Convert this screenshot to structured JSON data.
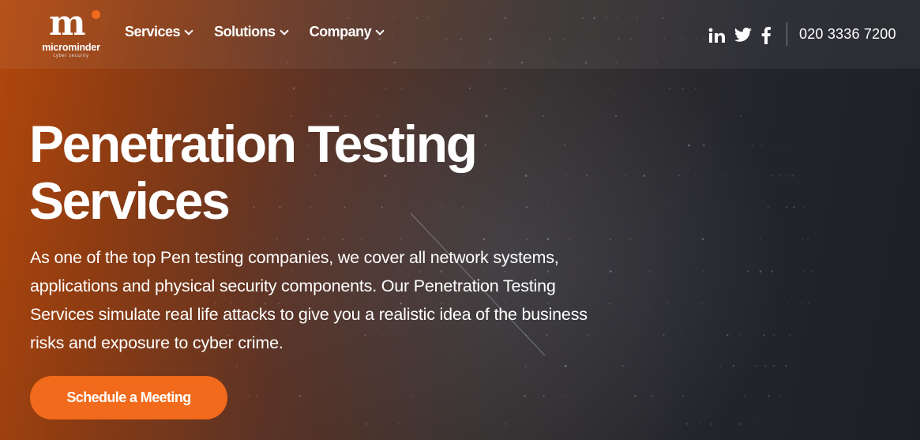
{
  "brand": {
    "mark": "m",
    "name": "microminder",
    "tagline": "cyber security",
    "accent_color": "#f26a1b"
  },
  "nav": {
    "items": [
      {
        "label": "Services",
        "icon": "chevron-down-icon"
      },
      {
        "label": "Solutions",
        "icon": "chevron-down-icon"
      },
      {
        "label": "Company",
        "icon": "chevron-down-icon"
      }
    ]
  },
  "social": {
    "icons": [
      "linkedin-icon",
      "twitter-icon",
      "facebook-icon"
    ]
  },
  "contact": {
    "phone": "020 3336 7200"
  },
  "hero": {
    "title_line1": "Penetration Testing",
    "title_line2": "Services",
    "description": "As one of the top Pen testing companies, we cover all network systems, applications and physical security components. Our Penetration Testing Services simulate real life attacks to give you a realistic idea of the business risks and exposure to cyber crime.",
    "cta_label": "Schedule a Meeting"
  }
}
